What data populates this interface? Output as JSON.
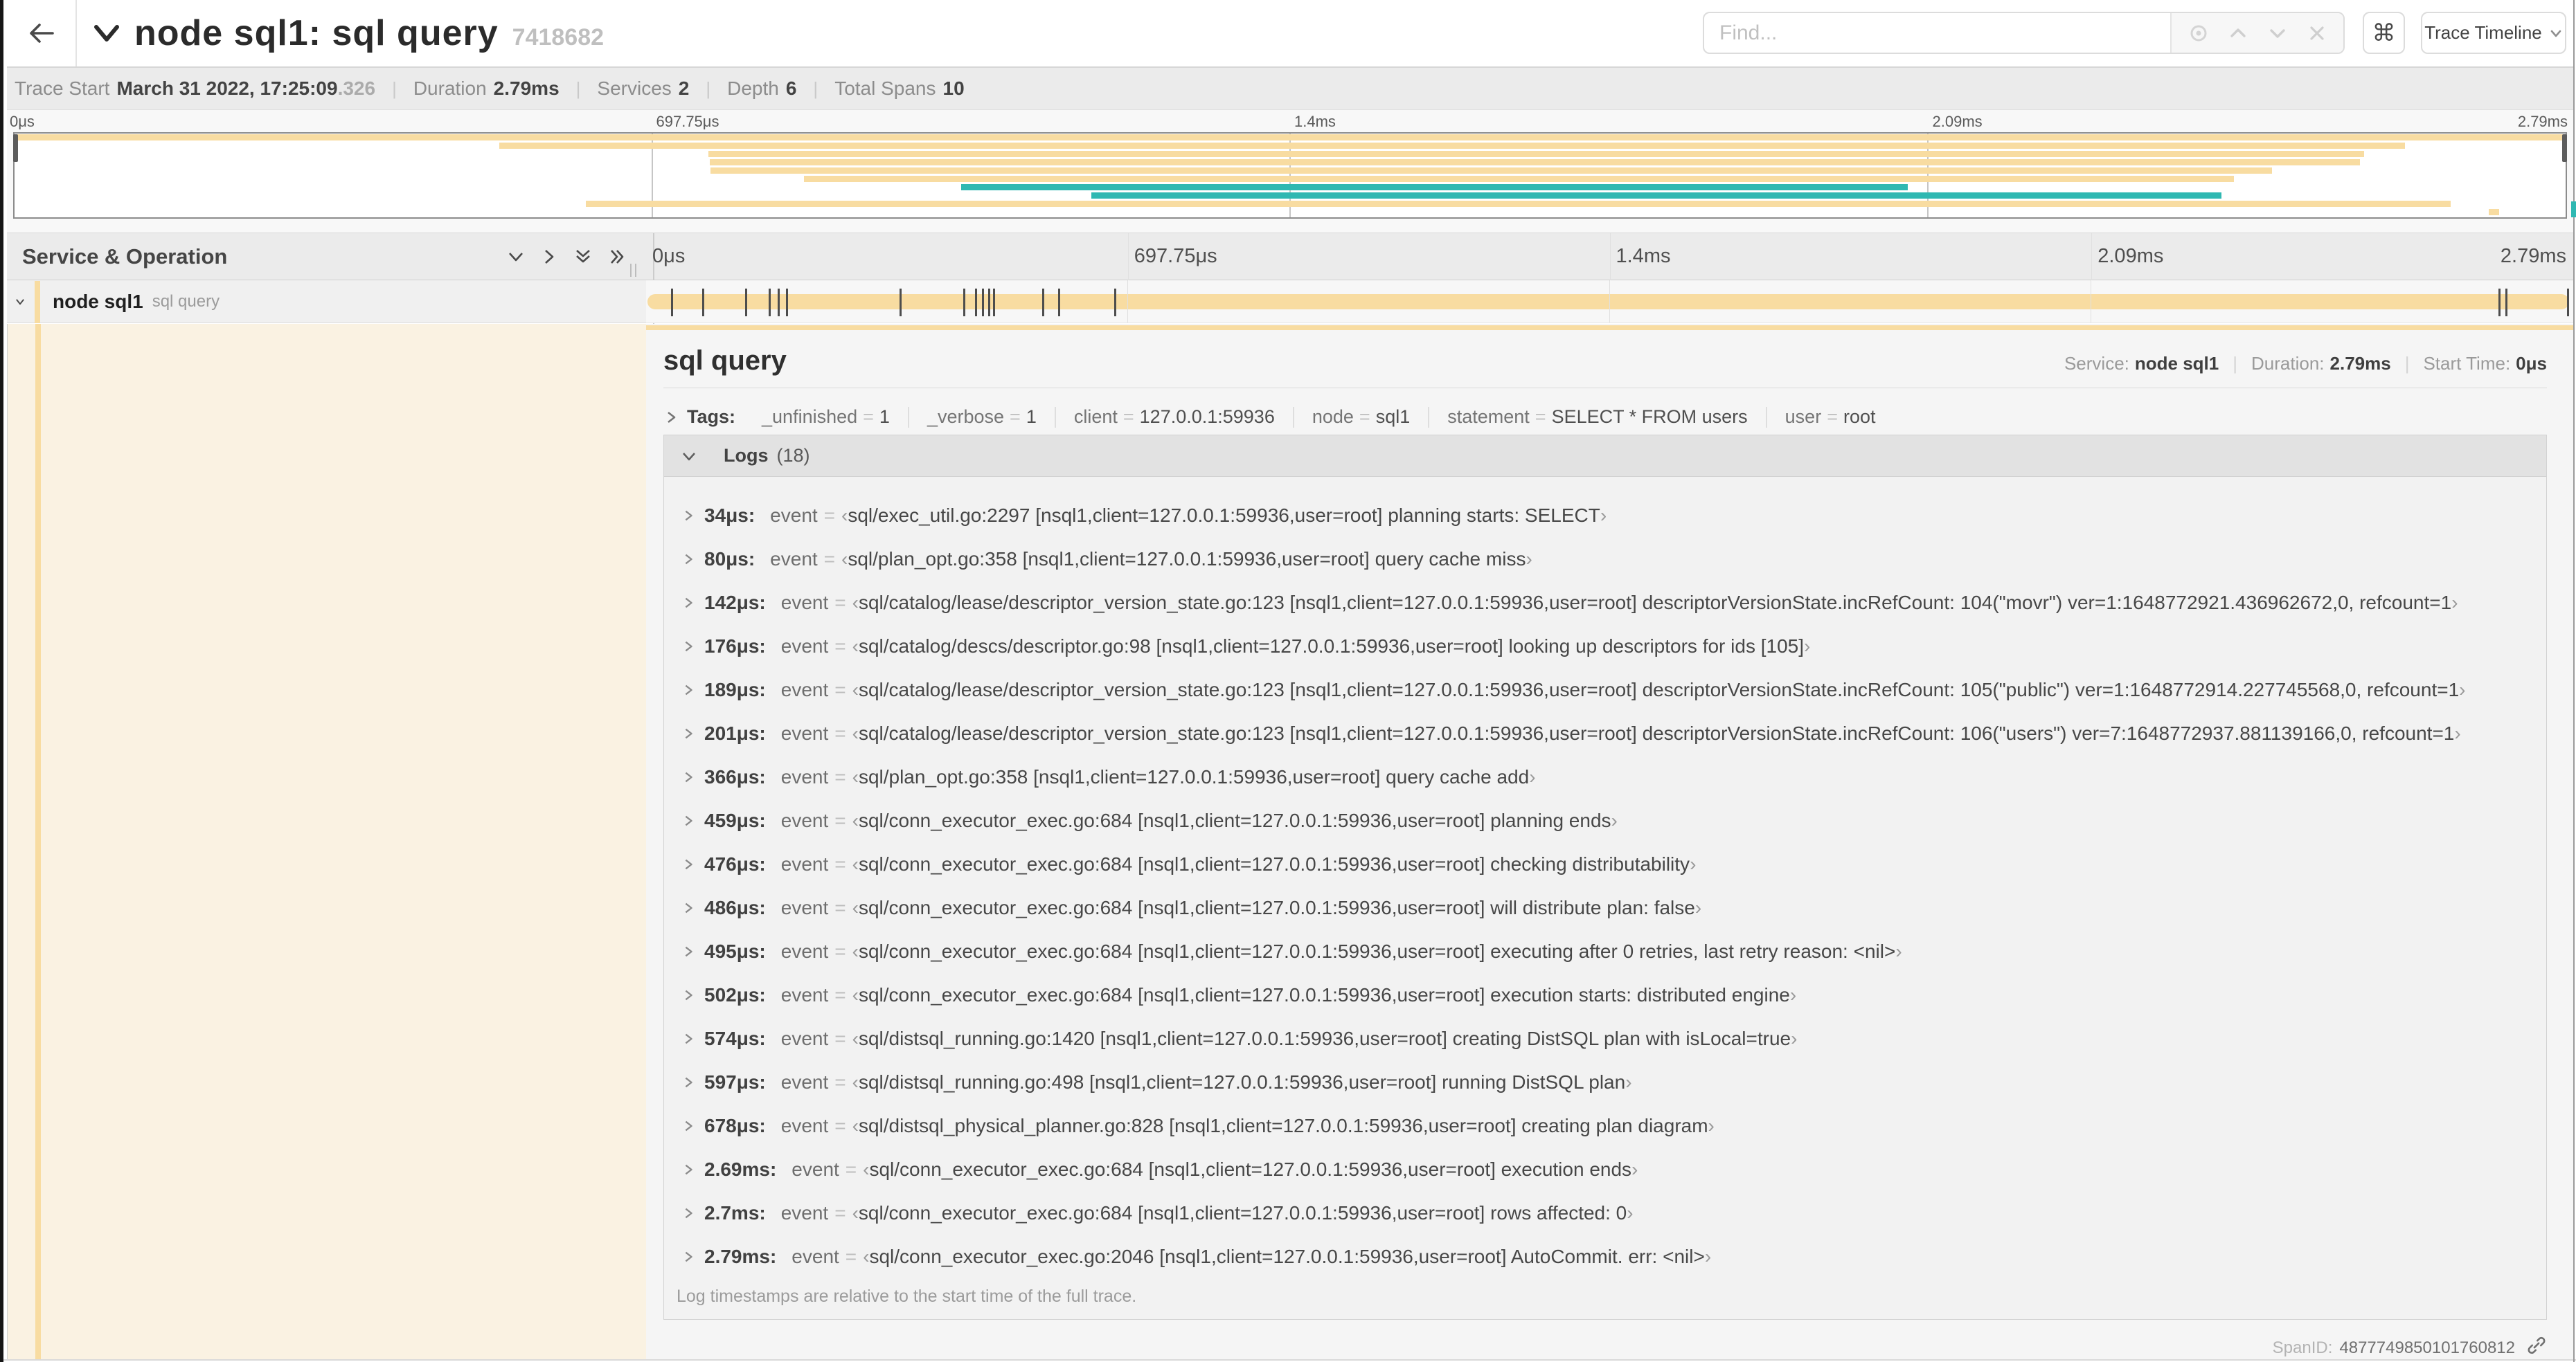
{
  "colors": {
    "span_tan": "#F8DCA1",
    "span_teal": "#2FB8B2",
    "detail_left_bg": "#FAF2E2",
    "marker": "#4D4D4D"
  },
  "header": {
    "back_icon": "arrow-left",
    "title": "node sql1: sql query",
    "trace_id_short": "7418682",
    "find_placeholder": "Find...",
    "keyboard_button": "⌘",
    "view_dropdown_label": "Trace Timeline"
  },
  "summary": {
    "trace_start_label": "Trace Start",
    "trace_start_value": "March 31 2022, 17:25:09",
    "trace_start_fraction": ".326",
    "duration_label": "Duration",
    "duration_value": "2.79ms",
    "services_label": "Services",
    "services_value": "2",
    "depth_label": "Depth",
    "depth_value": "6",
    "total_spans_label": "Total Spans",
    "total_spans_value": "10"
  },
  "chart_data": {
    "type": "gantt-minimap",
    "title": "trace span minimap",
    "duration_us": 2790,
    "tick_labels": [
      "0μs",
      "697.75μs",
      "1.4ms",
      "2.09ms",
      "2.79ms"
    ],
    "rows": [
      {
        "start": 0.0,
        "end": 1.0,
        "color": "tan"
      },
      {
        "start": 0.19,
        "end": 0.937,
        "color": "tan"
      },
      {
        "start": 0.272,
        "end": 0.921,
        "color": "tan"
      },
      {
        "start": 0.2725,
        "end": 0.9195,
        "color": "tan"
      },
      {
        "start": 0.2728,
        "end": 0.885,
        "color": "tan"
      },
      {
        "start": 0.3095,
        "end": 0.87,
        "color": "tan"
      },
      {
        "start": 0.371,
        "end": 0.742,
        "color": "teal"
      },
      {
        "start": 0.422,
        "end": 0.865,
        "color": "teal"
      },
      {
        "start": 0.224,
        "end": 0.955,
        "color": "tan"
      },
      {
        "start": 0.97,
        "end": 0.974,
        "color": "tan"
      }
    ]
  },
  "timeline": {
    "header_label": "Service & Operation",
    "tick_labels": [
      "0μs",
      "697.75μs",
      "1.4ms",
      "2.09ms",
      "2.79ms"
    ],
    "row": {
      "service": "node sql1",
      "operation": "sql query"
    },
    "duration_us": 2790,
    "log_marker_times_us": [
      34,
      80,
      142,
      176,
      189,
      201,
      366,
      459,
      476,
      486,
      495,
      502,
      574,
      597,
      678,
      2690,
      2700,
      2790
    ]
  },
  "detail": {
    "title": "sql query",
    "service_label": "Service:",
    "service_value": "node sql1",
    "duration_label": "Duration:",
    "duration_value": "2.79ms",
    "start_time_label": "Start Time:",
    "start_time_value": "0μs",
    "tags_label": "Tags:",
    "tags": [
      {
        "key": "_unfinished",
        "value": "1"
      },
      {
        "key": "_verbose",
        "value": "1"
      },
      {
        "key": "client",
        "value": "127.0.0.1:59936"
      },
      {
        "key": "node",
        "value": "sql1"
      },
      {
        "key": "statement",
        "value": "SELECT * FROM users"
      },
      {
        "key": "user",
        "value": "root"
      }
    ],
    "logs_label": "Logs",
    "logs_count": "(18)",
    "log_field_key": "event",
    "logs": [
      {
        "ts": "34μs:",
        "event": "sql/exec_util.go:2297 [nsql1,client=127.0.0.1:59936,user=root] planning starts: SELECT"
      },
      {
        "ts": "80μs:",
        "event": "sql/plan_opt.go:358 [nsql1,client=127.0.0.1:59936,user=root] query cache miss"
      },
      {
        "ts": "142μs:",
        "event": "sql/catalog/lease/descriptor_version_state.go:123 [nsql1,client=127.0.0.1:59936,user=root] descriptorVersionState.incRefCount: 104(\"movr\") ver=1:1648772921.436962672,0, refcount=1"
      },
      {
        "ts": "176μs:",
        "event": "sql/catalog/descs/descriptor.go:98 [nsql1,client=127.0.0.1:59936,user=root] looking up descriptors for ids [105]"
      },
      {
        "ts": "189μs:",
        "event": "sql/catalog/lease/descriptor_version_state.go:123 [nsql1,client=127.0.0.1:59936,user=root] descriptorVersionState.incRefCount: 105(\"public\") ver=1:1648772914.227745568,0, refcount=1"
      },
      {
        "ts": "201μs:",
        "event": "sql/catalog/lease/descriptor_version_state.go:123 [nsql1,client=127.0.0.1:59936,user=root] descriptorVersionState.incRefCount: 106(\"users\") ver=7:1648772937.881139166,0, refcount=1"
      },
      {
        "ts": "366μs:",
        "event": "sql/plan_opt.go:358 [nsql1,client=127.0.0.1:59936,user=root] query cache add"
      },
      {
        "ts": "459μs:",
        "event": "sql/conn_executor_exec.go:684 [nsql1,client=127.0.0.1:59936,user=root] planning ends"
      },
      {
        "ts": "476μs:",
        "event": "sql/conn_executor_exec.go:684 [nsql1,client=127.0.0.1:59936,user=root] checking distributability"
      },
      {
        "ts": "486μs:",
        "event": "sql/conn_executor_exec.go:684 [nsql1,client=127.0.0.1:59936,user=root] will distribute plan: false"
      },
      {
        "ts": "495μs:",
        "event": "sql/conn_executor_exec.go:684 [nsql1,client=127.0.0.1:59936,user=root] executing after 0 retries, last retry reason: <nil>"
      },
      {
        "ts": "502μs:",
        "event": "sql/conn_executor_exec.go:684 [nsql1,client=127.0.0.1:59936,user=root] execution starts: distributed engine"
      },
      {
        "ts": "574μs:",
        "event": "sql/distsql_running.go:1420 [nsql1,client=127.0.0.1:59936,user=root] creating DistSQL plan with isLocal=true"
      },
      {
        "ts": "597μs:",
        "event": "sql/distsql_running.go:498 [nsql1,client=127.0.0.1:59936,user=root] running DistSQL plan"
      },
      {
        "ts": "678μs:",
        "event": "sql/distsql_physical_planner.go:828 [nsql1,client=127.0.0.1:59936,user=root] creating plan diagram"
      },
      {
        "ts": "2.69ms:",
        "event": "sql/conn_executor_exec.go:684 [nsql1,client=127.0.0.1:59936,user=root] execution ends"
      },
      {
        "ts": "2.7ms:",
        "event": "sql/conn_executor_exec.go:684 [nsql1,client=127.0.0.1:59936,user=root] rows affected: 0"
      },
      {
        "ts": "2.79ms:",
        "event": "sql/conn_executor_exec.go:2046 [nsql1,client=127.0.0.1:59936,user=root] AutoCommit. err: <nil>"
      }
    ],
    "logs_note": "Log timestamps are relative to the start time of the full trace.",
    "span_id_label": "SpanID:",
    "span_id": "4877749850101760812"
  }
}
